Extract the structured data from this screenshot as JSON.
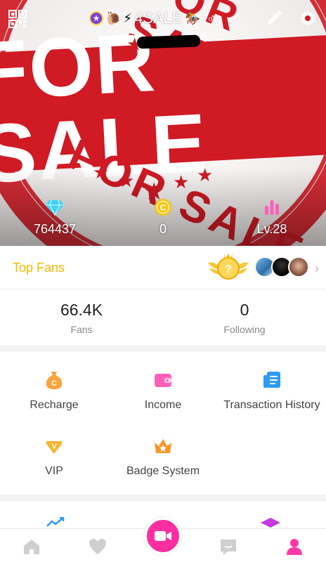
{
  "header": {
    "username": "4SALE",
    "badges": [
      "🐌",
      "⚡",
      "🏇"
    ],
    "banner_text": "FOR SALE",
    "stamp_top": "FOR SALE",
    "stamp_bottom": "FOR SALE"
  },
  "stats": {
    "diamonds": "764437",
    "coins": "0",
    "level": "Lv.28"
  },
  "top_fans": {
    "label": "Top Fans"
  },
  "counts": {
    "fans_value": "66.4K",
    "fans_label": "Fans",
    "following_value": "0",
    "following_label": "Following"
  },
  "menu": {
    "recharge": "Recharge",
    "income": "Income",
    "transaction_history": "Transaction History",
    "vip": "VIP",
    "badge_system": "Badge System"
  },
  "colors": {
    "accent_yellow": "#f5b800",
    "brand_pink": "#ff2fa0",
    "stamp_red": "#d01a24"
  },
  "icons": {
    "qr": "qr-code-icon",
    "edit": "pencil-icon",
    "settings": "gear-icon",
    "diamond": "diamond-icon",
    "coin": "coin-icon",
    "level": "bar-chart-icon",
    "recharge": "money-bag-icon",
    "income": "wallet-icon",
    "history": "document-list-icon",
    "vip": "vip-gem-icon",
    "badge": "crown-icon",
    "home": "home-icon",
    "heart": "heart-icon",
    "live": "video-camera-icon",
    "message": "message-icon",
    "profile": "profile-icon"
  }
}
